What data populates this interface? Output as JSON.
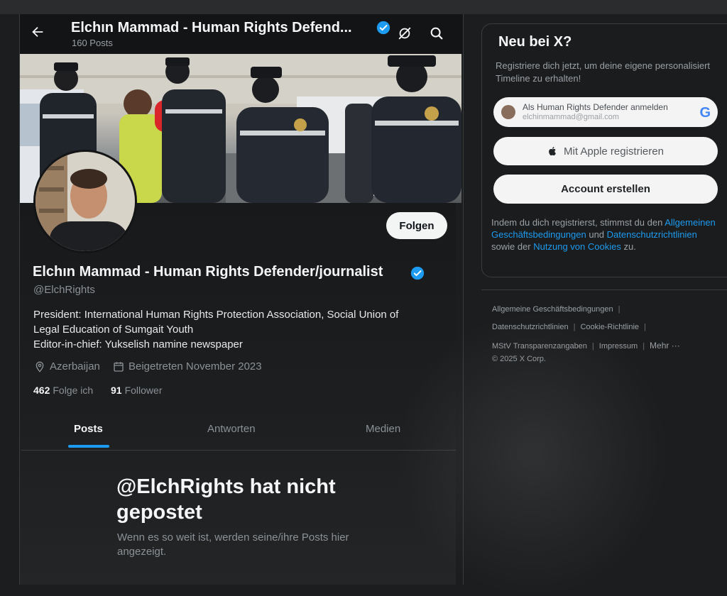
{
  "header": {
    "title": "Elchın Mammad - Human Rights Defend...",
    "posts_count": "160 Posts"
  },
  "profile": {
    "display_name": "Elchın Mammad - Human Rights Defender/journalist",
    "handle": "@ElchRights",
    "bio_lines": [
      "President: International Human Rights Protection Association, Social Union of",
      "Legal Education of Sumgait Youth",
      "Editor-in-chief: Yukselish namine newspaper"
    ],
    "location": "Azerbaijan",
    "joined": "Beigetreten November 2023",
    "following_count": "462",
    "following_label": "Folge ich",
    "followers_count": "91",
    "followers_label": "Follower",
    "follow_button": "Folgen",
    "verified_color": "#1d9bf0"
  },
  "tabs": [
    "Posts",
    "Antworten",
    "Medien"
  ],
  "active_tab": "Posts",
  "empty_state": {
    "title": "@ElchRights hat nicht gepostet",
    "subtitle": "Wenn es so weit ist, werden seine/ihre Posts hier angezeigt."
  },
  "signup": {
    "title": "Neu bei X?",
    "description": "Registriere dich jetzt, um deine eigene personalisiert Timeline zu erhalten!",
    "google_line1": "Als Human Rights Defender anmelden",
    "google_line2": "elchinmammad@gmail.com",
    "google_logo": "G",
    "apple_label": "Mit Apple registrieren",
    "create_label": "Account erstellen",
    "legal_prefix": "Indem du dich registrierst, stimmst du den",
    "legal_terms": "Allgemeinen Geschäftsbedingungen",
    "legal_and": "und",
    "legal_privacy": "Datenschutzrichtlinien",
    "legal_mid": "sowie der",
    "legal_cookies": "Nutzung von Cookies",
    "legal_suffix": "zu."
  },
  "footer": {
    "terms": "Allgemeine Geschäftsbedingungen",
    "privacy": "Datenschutzrichtlinien",
    "cookies": "Cookie-Richtlinie",
    "mstv": "MStV Transparenzangaben",
    "impressum": "Impressum",
    "more": "Mehr ···",
    "copyright": "© 2025 X Corp."
  },
  "colors": {
    "accent": "#1d9bf0",
    "background": "#121416"
  }
}
